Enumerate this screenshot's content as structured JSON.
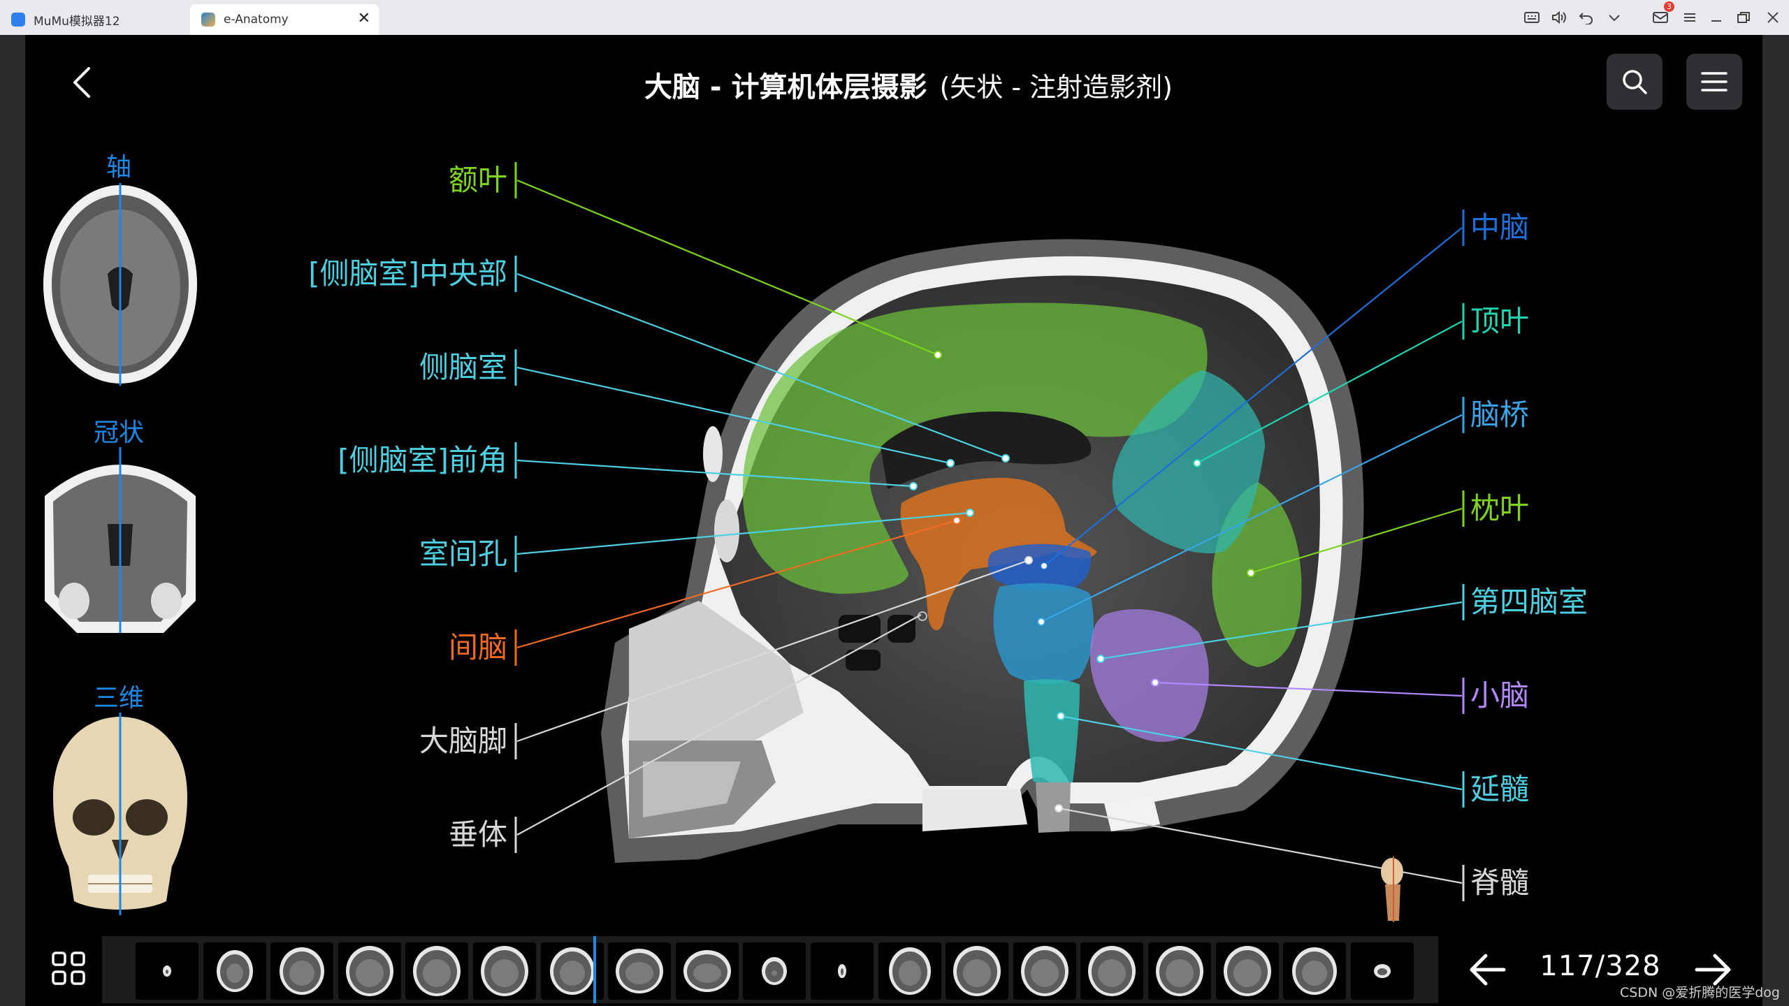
{
  "window": {
    "tabs": [
      {
        "label": "MuMu模拟器12",
        "active": false,
        "icon": "mumu-logo-icon"
      },
      {
        "label": "e-Anatomy",
        "active": true,
        "icon": "e-anatomy-logo-icon"
      }
    ],
    "notification_count": "3",
    "controls": [
      "keyboard-icon",
      "volume-icon",
      "undo-icon",
      "chevron-down-icon",
      "mail-icon",
      "menu-icon",
      "minimize-icon",
      "restore-icon",
      "close-icon"
    ]
  },
  "header": {
    "title": "大脑 - 计算机体层摄影",
    "subtitle": "(矢状 - 注射造影剂)",
    "buttons": [
      "back-icon",
      "search-icon",
      "menu-icon"
    ]
  },
  "views": {
    "axial": "轴",
    "coronal": "冠状",
    "three_d": "三维"
  },
  "labels_left": [
    {
      "text": "额叶",
      "color": "#7ed321"
    },
    {
      "text": "[侧脑室]中央部",
      "color": "#4dd0e1"
    },
    {
      "text": "侧脑室",
      "color": "#4dd0e1"
    },
    {
      "text": "[侧脑室]前角",
      "color": "#4dd0e1"
    },
    {
      "text": "室间孔",
      "color": "#4dd0e1"
    },
    {
      "text": "间脑",
      "color": "#f26a21"
    },
    {
      "text": "大脑脚",
      "color": "#d8d8d8"
    },
    {
      "text": "垂体",
      "color": "#d8d8d8"
    }
  ],
  "labels_right": [
    {
      "text": "中脑",
      "color": "#1e6fd9"
    },
    {
      "text": "顶叶",
      "color": "#22d3b0"
    },
    {
      "text": "脑桥",
      "color": "#3ba4e6"
    },
    {
      "text": "枕叶",
      "color": "#7ed321"
    },
    {
      "text": "第四脑室",
      "color": "#4dd0e1"
    },
    {
      "text": "小脑",
      "color": "#b388ff"
    },
    {
      "text": "延髓",
      "color": "#4dd0e1"
    },
    {
      "text": "脊髓",
      "color": "#d8d8d8"
    }
  ],
  "pager": {
    "current": "117/328",
    "prev": "arrow-left-icon",
    "next": "arrow-right-icon"
  },
  "thumbnail_count": 19,
  "watermark": "CSDN @爱折腾的医学dog"
}
